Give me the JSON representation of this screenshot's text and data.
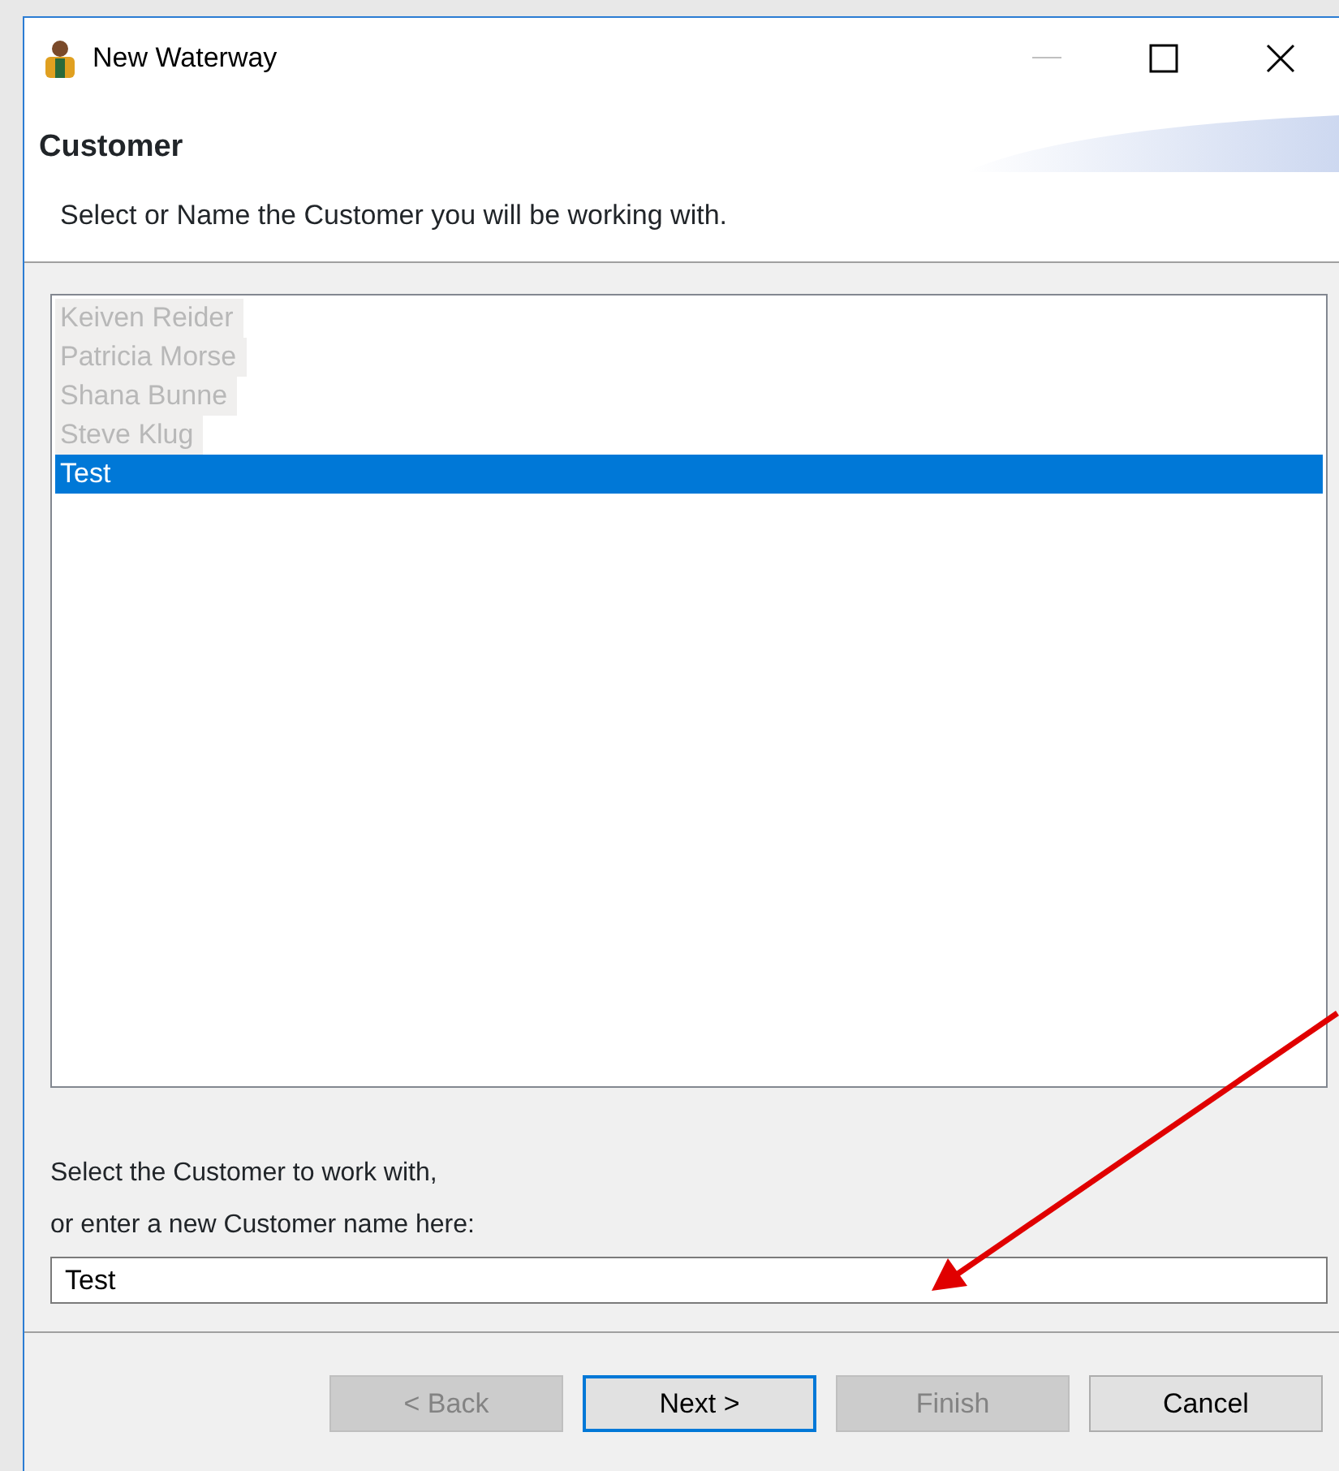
{
  "window": {
    "title": "New Waterway"
  },
  "header": {
    "title": "Customer",
    "subtitle": "Select or Name the Customer you will be working with."
  },
  "customers": [
    {
      "name": "Keiven Reider",
      "selected": false,
      "obscured": true
    },
    {
      "name": "Patricia Morse",
      "selected": false,
      "obscured": true
    },
    {
      "name": "Shana Bunne",
      "selected": false,
      "obscured": true
    },
    {
      "name": "Steve Klug",
      "selected": false,
      "obscured": true
    },
    {
      "name": "Test",
      "selected": true,
      "obscured": false
    }
  ],
  "prompt": [
    "Select the Customer to work with,",
    "or enter a new Customer name here:"
  ],
  "name_field": {
    "value": "Test"
  },
  "buttons": [
    {
      "label": "< Back",
      "disabled": true,
      "default": false
    },
    {
      "label": "Next >",
      "disabled": false,
      "default": true
    },
    {
      "label": "Finish",
      "disabled": true,
      "default": false
    },
    {
      "label": "Cancel",
      "disabled": false,
      "default": false
    }
  ]
}
